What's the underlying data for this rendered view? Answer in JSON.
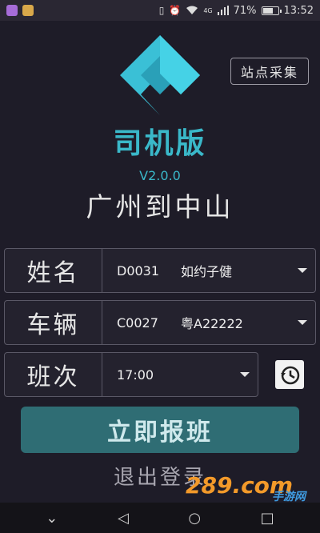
{
  "status_bar": {
    "battery_percent": "71%",
    "battery_level": 0.71,
    "time": "13:52",
    "network": "4G"
  },
  "header": {
    "collect_button": "站点采集",
    "app_title": "司机版",
    "version": "V2.0.0",
    "route": "广州到中山"
  },
  "form": {
    "name": {
      "label": "姓名",
      "code": "D0031",
      "value": "如约子健"
    },
    "vehicle": {
      "label": "车辆",
      "code": "C0027",
      "value": "粤A22222"
    },
    "shift": {
      "label": "班次",
      "value": "17:00"
    }
  },
  "actions": {
    "report": "立即报班",
    "logout": "退出登录"
  },
  "watermark": {
    "main": "289.com",
    "sub": "手游网"
  },
  "nav": {
    "back": "◁",
    "home": "○",
    "recents": "□",
    "menu": "⌄"
  },
  "colors": {
    "accent": "#3ab8c9",
    "report_button": "#2f6d74",
    "background": "#1e1c28"
  },
  "icons": [
    "logo-icon",
    "history-icon",
    "dropdown-caret-icon",
    "battery-icon",
    "wifi-icon",
    "alarm-icon",
    "vibrate-icon",
    "signal-icon"
  ]
}
